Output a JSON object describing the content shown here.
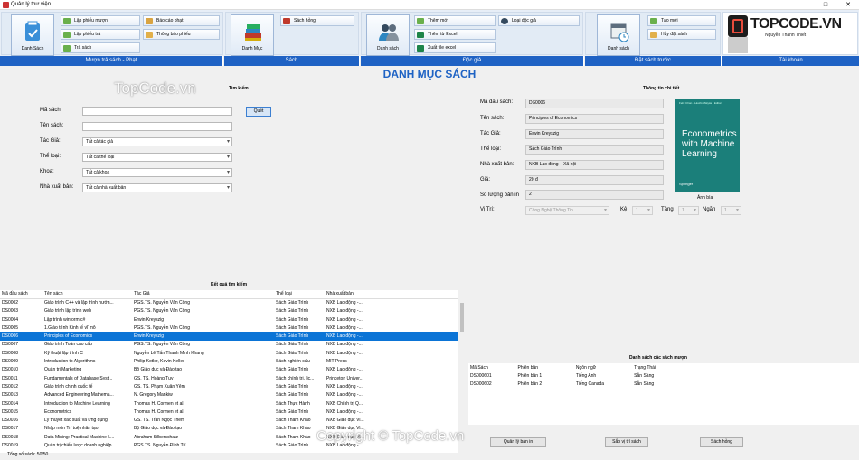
{
  "window": {
    "title": "Quản lý thư viện",
    "min": "–",
    "max": "□",
    "close": "✕"
  },
  "ribbon": {
    "danh_sach": "Danh Sách",
    "lap_phieu_muon": "Lập phiếu mượn",
    "lap_phieu_tra": "Lập phiếu trả",
    "tra_sach": "Trả sách",
    "bao_cao_phat": "Báo cáo phạt",
    "thong_bao_phieu": "Thông báo phiếu",
    "danh_muc": "Danh Mục",
    "sach_hong": "Sách hỏng",
    "danh_sach_dg": "Danh sách",
    "them_moi": "Thêm mới",
    "them_tu_excel": "Thêm từ Excel",
    "xuat_file_excel": "Xuất file excel",
    "loai_doc_gia": "Loại độc giả",
    "danh_sach_dst": "Danh sách",
    "tao_moi": "Tạo mới",
    "huy_dat_sach": "Hủy đặt sách",
    "brand": "TOPCODE.VN",
    "author": "Nguyễn Thanh Thiết"
  },
  "tabs": [
    "Mượn trả sách - Phạt",
    "Sách",
    "Độc giả",
    "Đặt sách trước",
    "Tài khoản"
  ],
  "page_title": "DANH MỤC SÁCH",
  "search": {
    "header": "Tìm kiếm",
    "ma_sach": "Mã sách:",
    "ten_sach": "Tên sách:",
    "tac_gia": "Tác Giả:",
    "the_loai": "Thể loại:",
    "khoa": "Khoa:",
    "nxb": "Nhà xuất bản:",
    "tac_gia_val": "Tất cả tác giả",
    "the_loai_val": "Tất cả thể loại",
    "khoa_val": "Tất cả khoa",
    "nxb_val": "Tất cả nhà xuất bản",
    "button": "Quét"
  },
  "detail": {
    "header": "Thông tin chi tiết",
    "ma_dau_sach": "Mã đầu sách:",
    "ma_dau_sach_val": "DS0006",
    "ten_sach": "Tên sách:",
    "ten_sach_val": "Principles of Economics",
    "tac_gia": "Tác Giả:",
    "tac_gia_val": "Erwin Kreyszig",
    "the_loai": "Thể loại:",
    "the_loai_val": "Sách Giáo Trình",
    "nxb": "Nhà xuất bản:",
    "nxb_val": "NXB Lao động – Xã hội",
    "gia": "Giá:",
    "gia_val": "20 đ",
    "so_luong": "Số lượng bản in",
    "so_luong_val": "2",
    "vi_tri": "Vị Trí:",
    "vi_tri_val": "Công Nghệ Thông Tin",
    "ke": "Kệ",
    "ke_val": "1",
    "tang": "Tầng",
    "tang_val": "1",
    "ngan": "Ngăn",
    "ngan_val": "1",
    "cover_title": "Econometrics with Machine Learning",
    "cover_caption": "Ảnh bìa",
    "cover_top": "Felix Chan · László Mátyás · Editors",
    "cover_brand": "Springer"
  },
  "results": {
    "header": "Kết quả tìm kiếm",
    "columns": [
      "Mã đầu sách",
      "Tên sách",
      "Tác Giả",
      "Thể loại",
      "Nhà xuất bản"
    ],
    "rows": [
      [
        "DS0002",
        "Giáo trình C++ và lập trình hướn...",
        "PGS.TS. Nguyễn Văn Công",
        "Sách Giáo Trình",
        "NXB Lao động -..."
      ],
      [
        "DS0003",
        "Giáo trình lập trình web",
        "PGS.TS. Nguyễn Văn Công",
        "Sách Giáo Trình",
        "NXB Lao động -..."
      ],
      [
        "DS0004",
        "Lập trình winform c#",
        "Erwin Kreyszig",
        "Sách Giáo Trình",
        "NXB Lao động -..."
      ],
      [
        "DS0005",
        "1.Giáo trình Kinh tế vĩ mô",
        "PGS.TS. Nguyễn Văn Công",
        "Sách Giáo Trình",
        "NXB Lao động -..."
      ],
      [
        "DS0006",
        "Principles of Economics",
        "Erwin Kreyszig",
        "Sách Giáo Trình",
        "NXB Lao động -..."
      ],
      [
        "DS0007",
        "Giáo trình Toán cao cấp",
        "PGS.TS. Nguyễn Văn Công",
        "Sách Giáo Trình",
        "NXB Lao động -..."
      ],
      [
        "DS0008",
        "Kỹ thuật lập trình C",
        "Nguyễn Lê Tấn Thanh Minh Khang",
        "Sách Giáo Trình",
        "NXB Lao động -..."
      ],
      [
        "DS0009",
        "Introduction to Algorithms",
        "Philip Kotler, Kevin Keller",
        "Sách nghiên cứu",
        "MIT Press"
      ],
      [
        "DS0010",
        "Quản trị Marketing",
        "Bộ Giáo dục và Đào tạo",
        "Sách Giáo Trình",
        "NXB Lao động -..."
      ],
      [
        "DS0011",
        "Fundamentals of Database Syst...",
        "GS. TS. Hoàng Tụy",
        "Sách chính trị, lịc...",
        "Princeton Univer..."
      ],
      [
        "DS0012",
        "Giáo trình chính quốc tế",
        "GS. TS. Phạm Xuân Yêm",
        "Sách Giáo Trình",
        "NXB Lao động -..."
      ],
      [
        "DS0013",
        "Advanced Engineering Mathema...",
        "N. Gregory Mankiw",
        "Sách Giáo Trình",
        "NXB Lao động -..."
      ],
      [
        "DS0014",
        "Introduction to Machine Learning",
        "Thomas H. Cormen et al.",
        "Sách Thực Hành",
        "NXB Chính trị Q..."
      ],
      [
        "DS0015",
        "Econometrics",
        "Thomas H. Cormen et al.",
        "Sách Giáo Trình",
        "NXB Lao động -..."
      ],
      [
        "DS0016",
        "Lý thuyết xác suất và ứng dụng",
        "GS. TS. Trần Ngọc Thêm",
        "Sách Tham Khảo",
        "NXB Giáo dục Vi..."
      ],
      [
        "DS0017",
        "Nhập môn Trí tuệ nhân tạo",
        "Bộ Giáo dục và Đào tạo",
        "Sách Tham Khảo",
        "NXB Giáo dục Vi..."
      ],
      [
        "DS0018",
        "Data Mining: Practical Machine L...",
        "Abraham Silberschatz",
        "Sách Tham Khảo",
        "NXB Giáo dục Vi..."
      ],
      [
        "DS0019",
        "Quản trị chiến lược doanh nghiệp",
        "PGS.TS. Nguyễn Đình Trí",
        "Sách Giáo Trình",
        "NXB Lao động -..."
      ]
    ],
    "selected_index": 4,
    "total": "Tổng số sách: 50/50"
  },
  "loans": {
    "header": "Danh sách các sách mượn",
    "columns": [
      "Mã Sách",
      "Phiên bản",
      "Ngôn ngữ",
      "Trạng Thái"
    ],
    "rows": [
      [
        "DS000601",
        "Phiên bản 1",
        "Tiếng Anh",
        "Sẵn Sàng"
      ],
      [
        "DS000602",
        "Phiên bản 2",
        "Tiếng Canada",
        "Sẵn Sàng"
      ]
    ],
    "btn1": "Quản lý bản in",
    "btn2": "Sắp vị trí sách",
    "btn3": "Sách hỏng"
  },
  "watermark": {
    "top": "TopCode.vn",
    "bottom": "Copyright © TopCode.vn"
  },
  "colors": {
    "tab_blue": "#1f62c4",
    "title_blue": "#1f63c4",
    "select_row": "#0b74d6"
  }
}
